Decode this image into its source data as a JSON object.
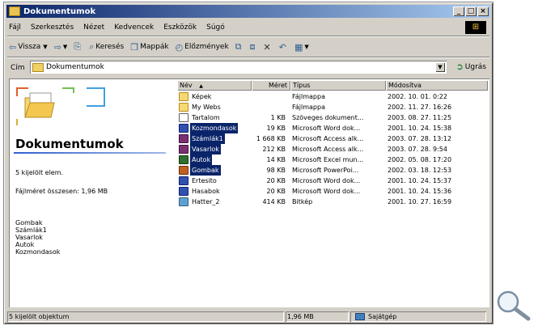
{
  "window": {
    "title": "Dokumentumok",
    "controls": [
      "_",
      "□",
      "×"
    ]
  },
  "menu": [
    "Fájl",
    "Szerkesztés",
    "Nézet",
    "Kedvencek",
    "Eszközök",
    "Súgó"
  ],
  "toolbar": {
    "back": "Vissza",
    "forward": "",
    "up": "",
    "search": "Keresés",
    "folders": "Mappák",
    "history": "Előzmények"
  },
  "address": {
    "label": "Cím",
    "value": "Dokumentumok",
    "go": "Ugrás"
  },
  "left_pane": {
    "title": "Dokumentumok",
    "selected_info": "5 kijelölt elem.",
    "size_info": "Fájlméret összesen: 1,96 MB",
    "selected_names": [
      "Gombak",
      "Számlák1",
      "Vasarlok",
      "Autok",
      "Kozmondasok"
    ]
  },
  "columns": {
    "name": "Név",
    "size": "Méret",
    "type": "Típus",
    "modified": "Módosítva"
  },
  "files": [
    {
      "name": "Képek",
      "size": "",
      "type": "Fájlmappa",
      "modified": "2002. 10. 01. 0:22",
      "icon": "folder-icon",
      "selected": false
    },
    {
      "name": "My Webs",
      "size": "",
      "type": "Fájlmappa",
      "modified": "2002. 11. 27. 16:26",
      "icon": "folder-icon",
      "selected": false
    },
    {
      "name": "Tartalom",
      "size": "1 KB",
      "type": "Szöveges dokument...",
      "modified": "2003. 08. 27. 11:25",
      "icon": "text-file-icon",
      "selected": false
    },
    {
      "name": "Kozmondasok",
      "size": "19 KB",
      "type": "Microsoft Word dok...",
      "modified": "2001. 10. 24. 15:38",
      "icon": "word-icon",
      "selected": true
    },
    {
      "name": "Számlák1",
      "size": "1 668 KB",
      "type": "Microsoft Access alk...",
      "modified": "2003. 07. 28. 13:12",
      "icon": "access-icon",
      "selected": true
    },
    {
      "name": "Vasarlok",
      "size": "212 KB",
      "type": "Microsoft Access alk...",
      "modified": "2003. 07. 28. 9:54",
      "icon": "access-icon",
      "selected": true
    },
    {
      "name": "Autok",
      "size": "14 KB",
      "type": "Microsoft Excel mun...",
      "modified": "2002. 05. 08. 17:20",
      "icon": "excel-icon",
      "selected": true
    },
    {
      "name": "Gombak",
      "size": "98 KB",
      "type": "Microsoft PowerPoi...",
      "modified": "2002. 03. 18. 12:53",
      "icon": "powerpoint-icon",
      "selected": true
    },
    {
      "name": "Ertesito",
      "size": "20 KB",
      "type": "Microsoft Word dok...",
      "modified": "2001. 10. 24. 15:37",
      "icon": "word-icon",
      "selected": false
    },
    {
      "name": "Hasabok",
      "size": "20 KB",
      "type": "Microsoft Word dok...",
      "modified": "2001. 10. 24. 15:36",
      "icon": "word-icon",
      "selected": false
    },
    {
      "name": "Hatter_2",
      "size": "414 KB",
      "type": "Bitkép",
      "modified": "2001. 10. 27. 16:59",
      "icon": "bitmap-icon",
      "selected": false
    }
  ],
  "status": {
    "text": "5 kijelölt objektum",
    "size": "1,96 MB",
    "location": "Sajátgép"
  },
  "colors": {
    "selection": "#0a246a",
    "titlebar_start": "#0a246a",
    "titlebar_end": "#a6caf0",
    "face": "#d4d0c8"
  }
}
